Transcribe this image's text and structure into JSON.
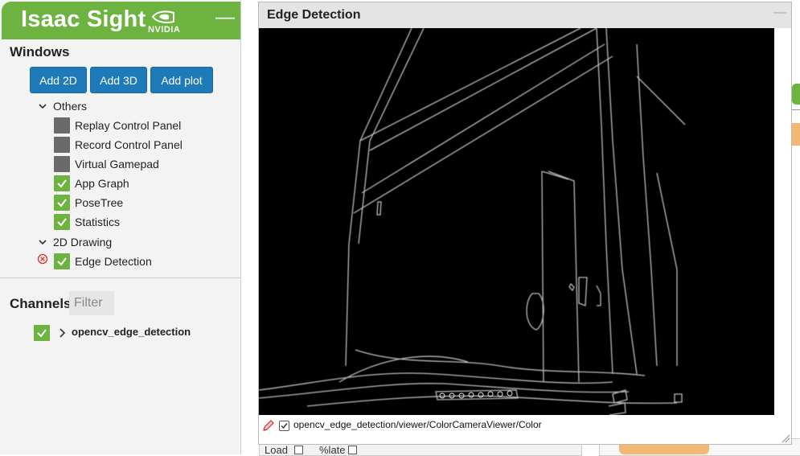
{
  "sidebar": {
    "title": "Isaac Sight",
    "logo_text": "NVIDIA",
    "minimize_icon": "minus-icon",
    "windows": {
      "title": "Windows",
      "buttons": [
        {
          "label": "Add 2D"
        },
        {
          "label": "Add 3D"
        },
        {
          "label": "Add plot"
        }
      ],
      "groups": [
        {
          "label": "Others",
          "items": [
            {
              "label": "Replay Control Panel",
              "checked": false
            },
            {
              "label": "Record Control Panel",
              "checked": false
            },
            {
              "label": "Virtual Gamepad",
              "checked": false
            },
            {
              "label": "App Graph",
              "checked": true
            },
            {
              "label": "PoseTree",
              "checked": true
            },
            {
              "label": "Statistics",
              "checked": true
            }
          ]
        },
        {
          "label": "2D Drawing",
          "items": [
            {
              "label": "Edge Detection",
              "checked": true,
              "removable": true
            }
          ]
        }
      ]
    },
    "channels": {
      "title": "Channels",
      "filter_placeholder": "Filter",
      "items": [
        {
          "label": "opencv_edge_detection",
          "checked": true
        }
      ]
    }
  },
  "edge_window": {
    "title": "Edge Detection",
    "channel_path": "opencv_edge_detection/viewer/ColorCameraViewer/Color",
    "channel_checked": true
  },
  "background": {
    "stats_labels": [
      "Load",
      "%late"
    ]
  },
  "colors": {
    "accent_green": "#6db33f",
    "button_blue": "#1e7ab8",
    "checkbox_off": "#6a6a6a"
  }
}
